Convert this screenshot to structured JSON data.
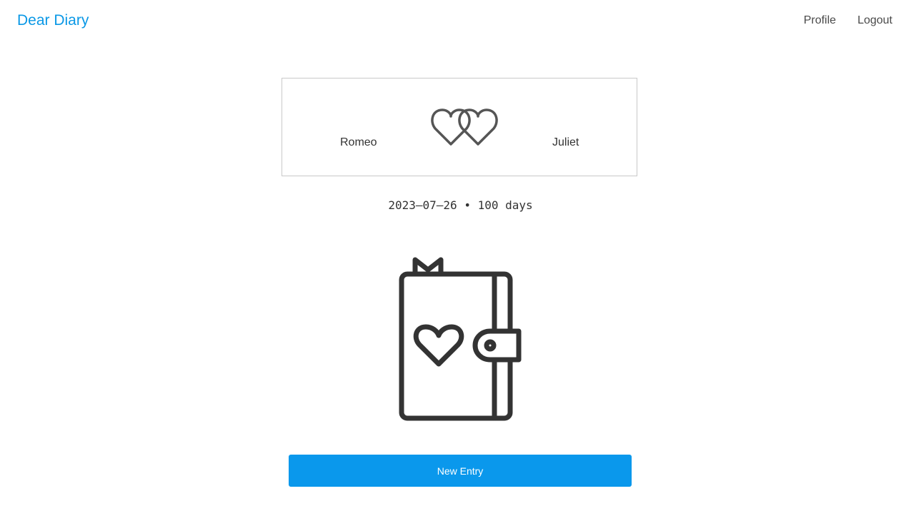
{
  "header": {
    "brand": "Dear Diary",
    "nav": {
      "profile": "Profile",
      "logout": "Logout"
    }
  },
  "couple": {
    "partner_left": "Romeo",
    "partner_right": "Juliet",
    "center_icon": "intertwined-hearts-icon"
  },
  "relationship": {
    "start_date": "2023–07–26",
    "separator": "•",
    "duration": "100 days"
  },
  "diary": {
    "icon": "diary-book-icon"
  },
  "actions": {
    "new_entry": "New Entry"
  },
  "colors": {
    "accent": "#0a98e6",
    "button": "#0a98ec",
    "icon_stroke": "#333333",
    "border": "#c9c9c9"
  }
}
